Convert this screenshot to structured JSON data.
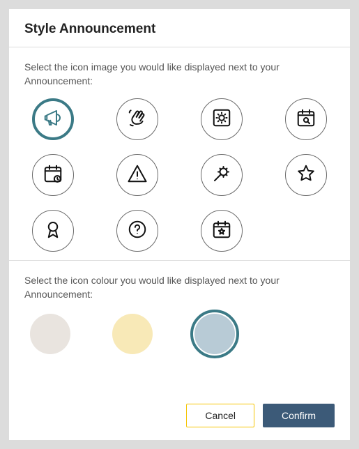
{
  "modal": {
    "title": "Style Announcement",
    "icon_section_label": "Select the icon image you would like displayed next to your Announcement:",
    "colour_section_label": "Select the icon colour you would like displayed next to your Announcement:",
    "icons": [
      {
        "name": "megaphone-icon",
        "label": "Megaphone",
        "selected": true
      },
      {
        "name": "hand-wave-icon",
        "label": "Wave",
        "selected": false
      },
      {
        "name": "system-gear-icon",
        "label": "System settings",
        "selected": false
      },
      {
        "name": "calendar-search-icon",
        "label": "Calendar search",
        "selected": false
      },
      {
        "name": "calendar-clock-icon",
        "label": "Calendar timed",
        "selected": false
      },
      {
        "name": "warning-icon",
        "label": "Warning",
        "selected": false
      },
      {
        "name": "tools-gear-icon",
        "label": "Maintenance",
        "selected": false
      },
      {
        "name": "star-icon",
        "label": "Star",
        "selected": false
      },
      {
        "name": "ribbon-icon",
        "label": "Award",
        "selected": false
      },
      {
        "name": "help-icon",
        "label": "Help",
        "selected": false
      },
      {
        "name": "calendar-star-icon",
        "label": "Calendar feature",
        "selected": false
      }
    ],
    "colours": [
      {
        "name": "colour-neutral",
        "hex": "#e9e4df",
        "label": "Neutral",
        "selected": false
      },
      {
        "name": "colour-cream",
        "hex": "#f8e9b7",
        "label": "Cream",
        "selected": false
      },
      {
        "name": "colour-blue",
        "hex": "#b8cbd6",
        "label": "Blue",
        "selected": true
      }
    ],
    "buttons": {
      "cancel": "Cancel",
      "confirm": "Confirm"
    }
  }
}
